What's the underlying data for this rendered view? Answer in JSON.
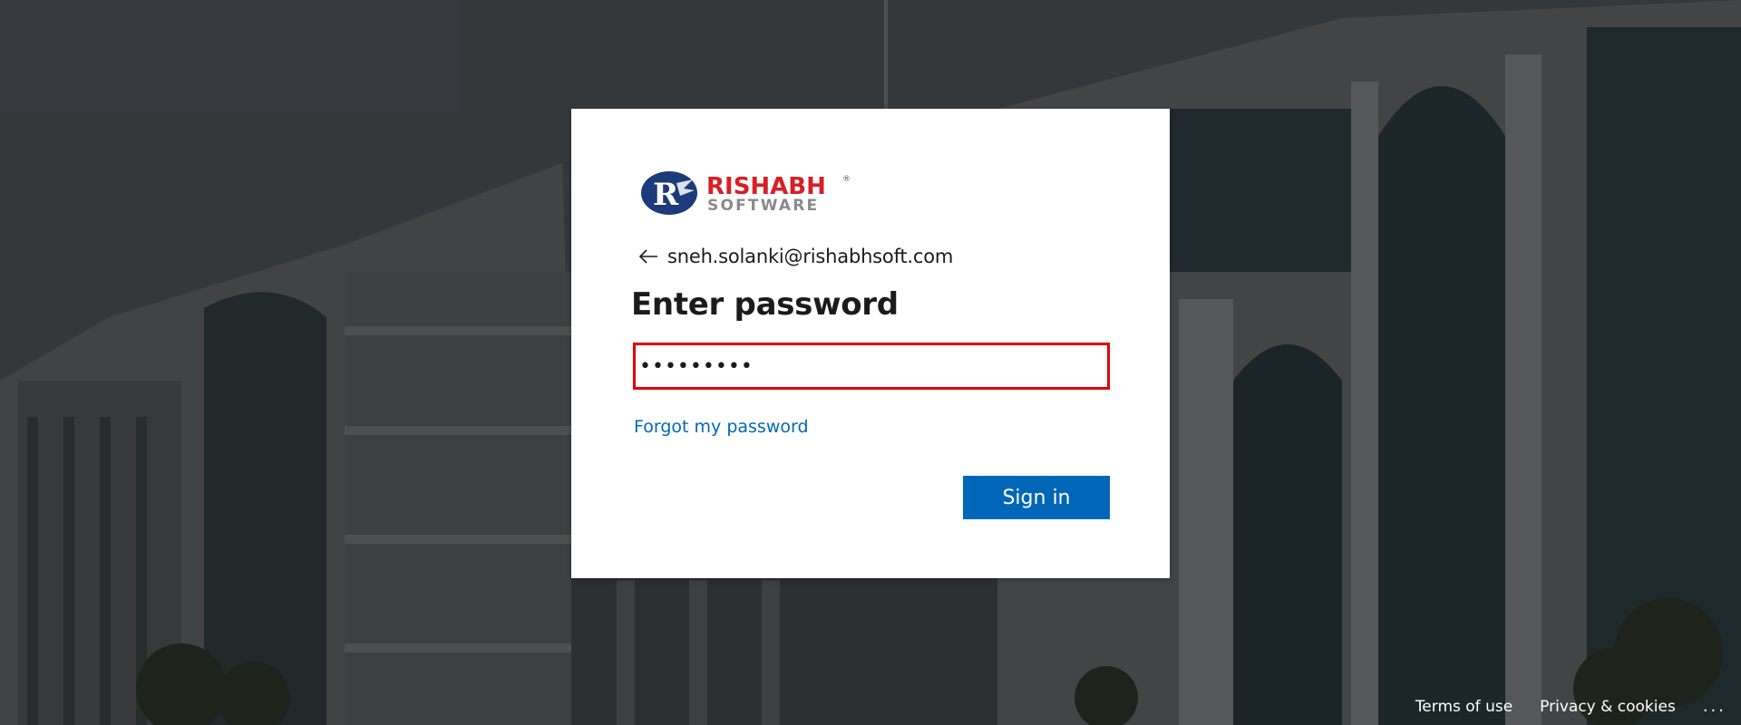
{
  "page": {
    "title": "Enter password"
  },
  "brand": {
    "name_top": "RISHABH",
    "name_bottom": "SOFTWARE",
    "registered_mark": "®",
    "logo_icon": "rishabh-logo-icon",
    "color_red": "#d71f26",
    "color_navy": "#1d3a7a"
  },
  "identity": {
    "email": "sneh.solanki@rishabhsoft.com",
    "back_icon": "back-arrow-icon"
  },
  "password": {
    "value": "•••••••••",
    "border_color": "#e00000"
  },
  "links": {
    "forgot": "Forgot my password"
  },
  "actions": {
    "signin_label": "Sign in",
    "accent": "#0067b8"
  },
  "footer": {
    "terms": "Terms of use",
    "privacy": "Privacy & cookies",
    "more": "..."
  }
}
